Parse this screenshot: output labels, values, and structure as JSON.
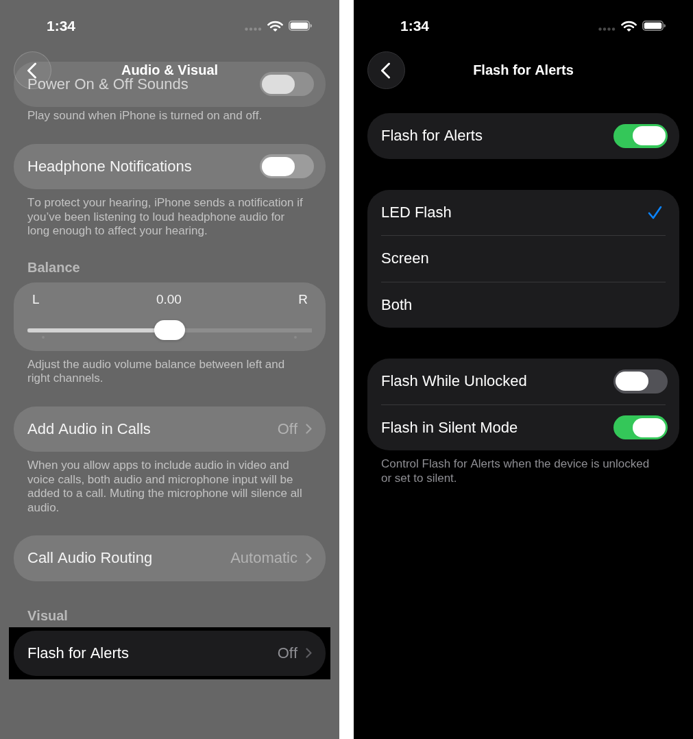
{
  "screens": [
    {
      "dimmed": true,
      "status_bar": {
        "time": "1:34"
      },
      "nav": {
        "title": "Audio & Visual"
      },
      "groups": [
        {
          "scrolled_under": true,
          "highlighted": false,
          "rows": [
            {
              "kind": "toggle",
              "label": "Power On & Off Sounds",
              "on": false
            }
          ],
          "footer": "Play sound when iPhone is turned on and off."
        },
        {
          "scrolled_under": false,
          "highlighted": false,
          "rows": [
            {
              "kind": "toggle",
              "label": "Headphone Notifications",
              "on": false
            }
          ],
          "footer": "To protect your hearing, iPhone sends a notification if you’ve been listening to loud headphone audio for long enough to affect your hearing."
        },
        {
          "scrolled_under": false,
          "highlighted": false,
          "header": "Balance",
          "rows": [
            {
              "kind": "slider",
              "left_label": "L",
              "reading": "0.00",
              "right_label": "R",
              "level": 0.5
            }
          ],
          "footer": "Adjust the audio volume balance between left and right channels."
        },
        {
          "scrolled_under": false,
          "highlighted": false,
          "rows": [
            {
              "kind": "value",
              "label": "Add Audio in Calls",
              "value": "Off"
            }
          ],
          "footer": "When you allow apps to include audio in video and voice calls, both audio and microphone input will be added to a call. Muting the microphone will silence all audio."
        },
        {
          "scrolled_under": false,
          "highlighted": false,
          "rows": [
            {
              "kind": "value",
              "label": "Call Audio Routing",
              "value": "Automatic"
            }
          ]
        },
        {
          "scrolled_under": false,
          "highlighted": true,
          "header": "Visual",
          "rows": [
            {
              "kind": "value",
              "label": "Flash for Alerts",
              "value": "Off"
            }
          ]
        }
      ]
    },
    {
      "dimmed": false,
      "status_bar": {
        "time": "1:34"
      },
      "nav": {
        "title": "Flash for Alerts"
      },
      "groups": [
        {
          "rows": [
            {
              "kind": "toggle",
              "label": "Flash for Alerts",
              "on": true
            }
          ]
        },
        {
          "rows": [
            {
              "kind": "check",
              "label": "LED Flash",
              "selected": true
            },
            {
              "kind": "check",
              "label": "Screen",
              "selected": false
            },
            {
              "kind": "check",
              "label": "Both",
              "selected": false
            }
          ]
        },
        {
          "rows": [
            {
              "kind": "toggle",
              "label": "Flash While Unlocked",
              "on": false
            },
            {
              "kind": "toggle",
              "label": "Flash in Silent Mode",
              "on": true
            }
          ],
          "footer": "Control Flash for Alerts when the device is unlocked or set to silent."
        }
      ]
    }
  ]
}
